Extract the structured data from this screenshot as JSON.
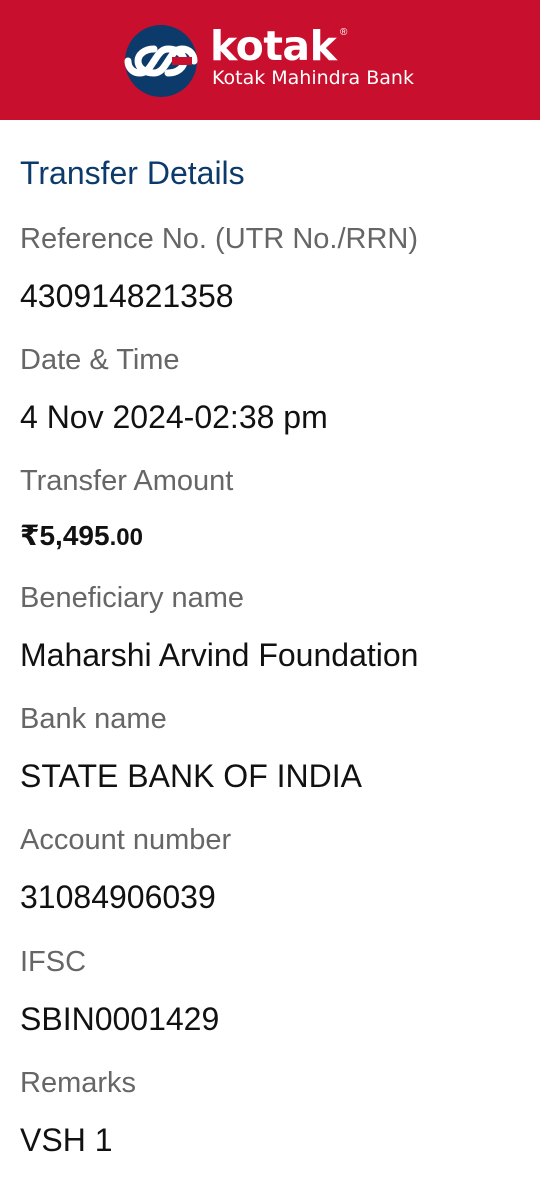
{
  "brand": {
    "name": "kotak",
    "registered_mark": "®",
    "subtitle": "Kotak Mahindra Bank",
    "header_color": "#c8102e",
    "logo_bg_color": "#0b3a6b"
  },
  "section_title": "Transfer Details",
  "fields": {
    "reference": {
      "label": "Reference No. (UTR No./RRN)",
      "value": "430914821358"
    },
    "date_time": {
      "label": "Date & Time",
      "value": "4 Nov 2024-02:38 pm"
    },
    "amount": {
      "label": "Transfer Amount",
      "value_main": "₹5,495",
      "value_decimal": ".00"
    },
    "beneficiary": {
      "label": "Beneficiary name",
      "value": "Maharshi Arvind Foundation"
    },
    "bank": {
      "label": "Bank name",
      "value": "STATE BANK OF INDIA"
    },
    "account": {
      "label": "Account number",
      "value": "31084906039"
    },
    "ifsc": {
      "label": "IFSC",
      "value": "SBIN0001429"
    },
    "remarks": {
      "label": "Remarks",
      "value": "VSH 1"
    }
  }
}
